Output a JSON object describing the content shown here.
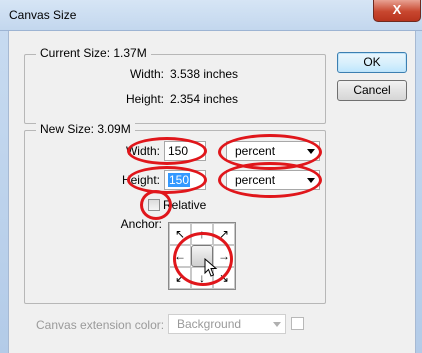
{
  "window": {
    "title": "Canvas Size",
    "close_glyph": "X"
  },
  "buttons": {
    "ok": "OK",
    "cancel": "Cancel"
  },
  "current_size": {
    "legend": "Current Size: 1.37M",
    "width_label": "Width:",
    "width_value": "3.538 inches",
    "height_label": "Height:",
    "height_value": "2.354 inches"
  },
  "new_size": {
    "legend": "New Size: 3.09M",
    "width_label": "Width:",
    "width_value": "150",
    "width_unit": "percent",
    "height_label": "Height:",
    "height_value": "150",
    "height_unit": "percent",
    "relative_label": "Relative",
    "relative_checked": false,
    "anchor_label": "Anchor:"
  },
  "anchor_icons": {
    "arrows": [
      "↖",
      "↑",
      "↗",
      "←",
      "",
      "→",
      "↙",
      "↓",
      "↘"
    ]
  },
  "extension": {
    "label": "Canvas extension color:",
    "value": "Background"
  },
  "colors": {
    "annotation": "#e0161b",
    "selection": "#3399ff"
  }
}
